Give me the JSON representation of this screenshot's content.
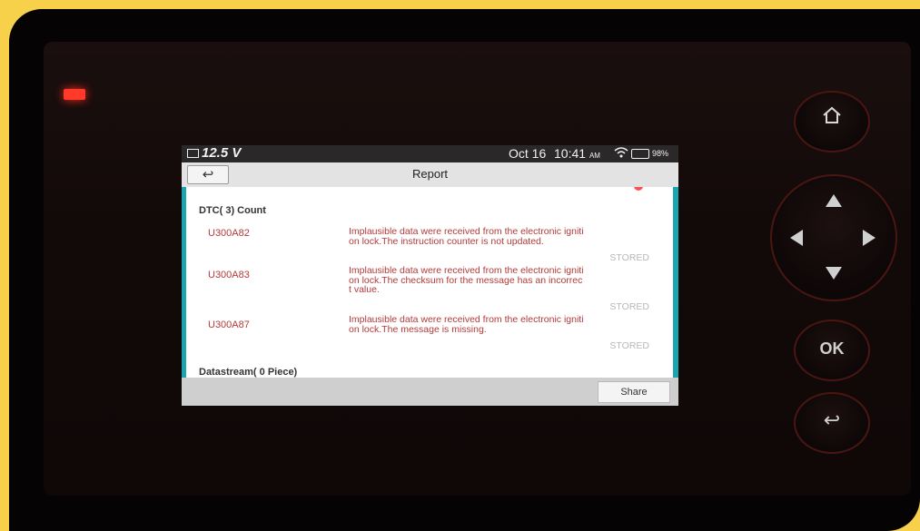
{
  "status_bar": {
    "voltage": "12.5 V",
    "date": "Oct 16",
    "time": "10:41",
    "ampm": "AM",
    "battery_percent": "98%"
  },
  "header": {
    "back_icon": "↩",
    "title": "Report"
  },
  "report": {
    "dtc_title": "DTC( 3) Count",
    "dtcs": [
      {
        "code": "U300A82",
        "desc_line1": "Implausible data were received from the electronic igniti",
        "desc_line2": "on lock.The instruction counter is not updated.",
        "desc_line3": "",
        "status": "STORED"
      },
      {
        "code": "U300A83",
        "desc_line1": "Implausible data were received from the electronic igniti",
        "desc_line2": "on lock.The checksum for the message has an incorrec",
        "desc_line3": "t value.",
        "status": "STORED"
      },
      {
        "code": "U300A87",
        "desc_line1": "Implausible data were received from the electronic igniti",
        "desc_line2": "on lock.The message is missing.",
        "desc_line3": "",
        "status": "STORED"
      }
    ],
    "datastream_title": "Datastream( 0 Piece)"
  },
  "footer": {
    "share_label": "Share"
  },
  "hardware": {
    "ok_label": "OK",
    "home_icon": "⌂",
    "return_icon": "↩"
  },
  "colors": {
    "accent_teal": "#1ba5b0",
    "dtc_red": "#b23a3a",
    "stored_gray": "#b8b8b8"
  }
}
